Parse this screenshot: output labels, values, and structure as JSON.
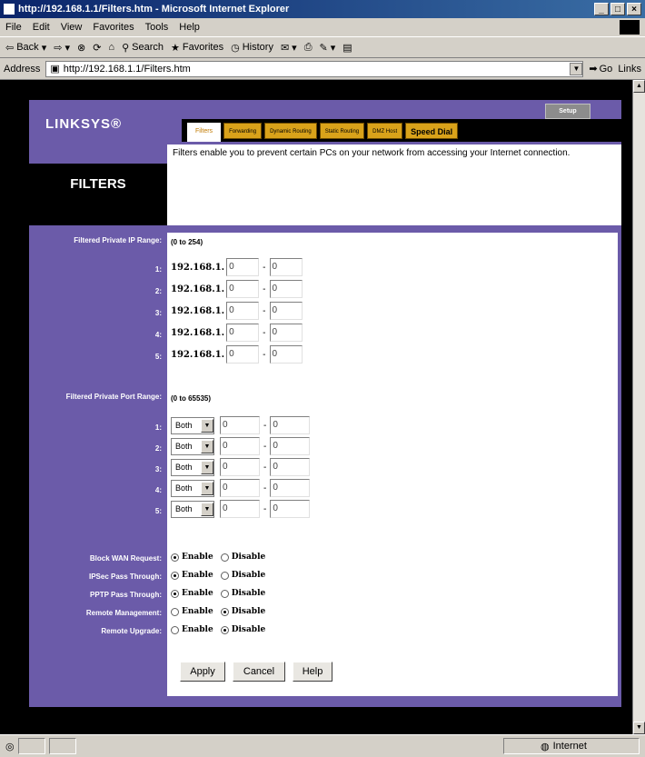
{
  "window": {
    "title": "http://192.168.1.1/Filters.htm - Microsoft Internet Explorer"
  },
  "menu": [
    "File",
    "Edit",
    "View",
    "Favorites",
    "Tools",
    "Help"
  ],
  "toolbar": {
    "back": "Back",
    "search": "Search",
    "favorites": "Favorites",
    "history": "History"
  },
  "address": {
    "label": "Address",
    "url": "http://192.168.1.1/Filters.htm",
    "go": "Go",
    "links": "Links"
  },
  "status": {
    "zone": "Internet"
  },
  "page": {
    "brand": "LINKSYS",
    "tabs": [
      "Filters",
      "Forwarding",
      "Dynamic Routing",
      "Static Routing",
      "DMZ Host"
    ],
    "speed_dial": "Speed Dial",
    "setup": "Setup",
    "section_title": "FILTERS",
    "description": "Filters enable you to prevent certain PCs on your network from accessing your Internet connection.",
    "ip_label": "Filtered Private IP Range:",
    "ip_hint": "(0 to 254)",
    "ip_prefix": "192.168.1.",
    "ip_rows": [
      {
        "n": "1:",
        "from": "0",
        "to": "0"
      },
      {
        "n": "2:",
        "from": "0",
        "to": "0"
      },
      {
        "n": "3:",
        "from": "0",
        "to": "0"
      },
      {
        "n": "4:",
        "from": "0",
        "to": "0"
      },
      {
        "n": "5:",
        "from": "0",
        "to": "0"
      }
    ],
    "port_label": "Filtered Private Port Range:",
    "port_hint": "(0 to 65535)",
    "port_rows": [
      {
        "n": "1:",
        "proto": "Both",
        "from": "0",
        "to": "0"
      },
      {
        "n": "2:",
        "proto": "Both",
        "from": "0",
        "to": "0"
      },
      {
        "n": "3:",
        "proto": "Both",
        "from": "0",
        "to": "0"
      },
      {
        "n": "4:",
        "proto": "Both",
        "from": "0",
        "to": "0"
      },
      {
        "n": "5:",
        "proto": "Both",
        "from": "0",
        "to": "0"
      }
    ],
    "enable": "Enable",
    "disable": "Disable",
    "toggles": [
      {
        "label": "Block WAN Request:",
        "state": "enable"
      },
      {
        "label": "IPSec Pass Through:",
        "state": "enable"
      },
      {
        "label": "PPTP Pass Through:",
        "state": "enable"
      },
      {
        "label": "Remote Management:",
        "state": "disable"
      },
      {
        "label": "Remote Upgrade:",
        "state": "disable"
      }
    ],
    "buttons": {
      "apply": "Apply",
      "cancel": "Cancel",
      "help": "Help"
    }
  },
  "colors": {
    "frame": "#6b5ba9",
    "tab": "#d9a21a",
    "titlebar": "#0a246a"
  }
}
